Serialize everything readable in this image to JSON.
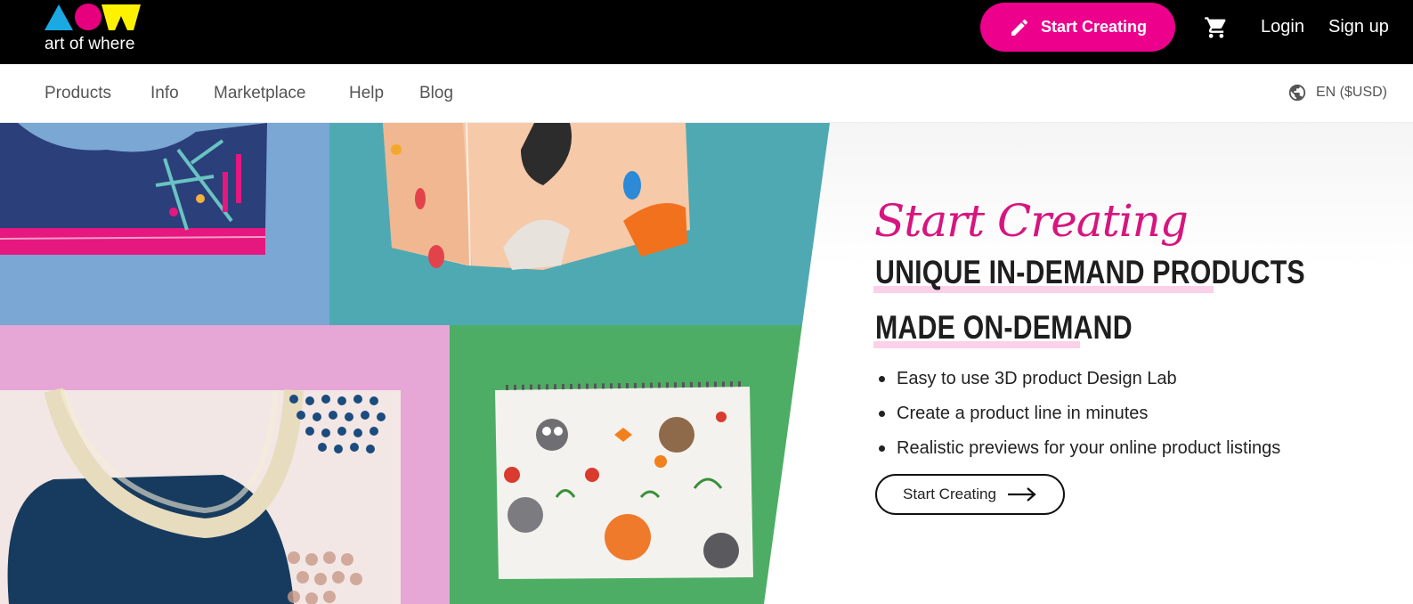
{
  "header": {
    "logo_text": "art of where",
    "cta_label": "Start Creating",
    "login_label": "Login",
    "signup_label": "Sign up",
    "colors": {
      "brand_pink": "#ec008c",
      "logo_cyan": "#1ba9e2",
      "logo_magenta": "#e6007e",
      "logo_yellow": "#fff200"
    }
  },
  "nav": {
    "items": [
      {
        "label": "Products"
      },
      {
        "label": "Info"
      },
      {
        "label": "Marketplace"
      },
      {
        "label": "Help"
      },
      {
        "label": "Blog"
      }
    ],
    "locale_label": "EN ($USD)"
  },
  "hero": {
    "script_title": "Start Creating",
    "headline_line1": "UNIQUE IN-DEMAND PRODUCTS",
    "headline_line2": "MADE ON-DEMAND",
    "bullets": [
      "Easy to use 3D product Design Lab",
      "Create a product line in minutes",
      "Realistic previews for your online product listings"
    ],
    "button_label": "Start Creating",
    "image_icons": [
      "crop-top-product",
      "silk-scarf-product",
      "tote-bag-product",
      "spiral-notebook-product"
    ]
  }
}
